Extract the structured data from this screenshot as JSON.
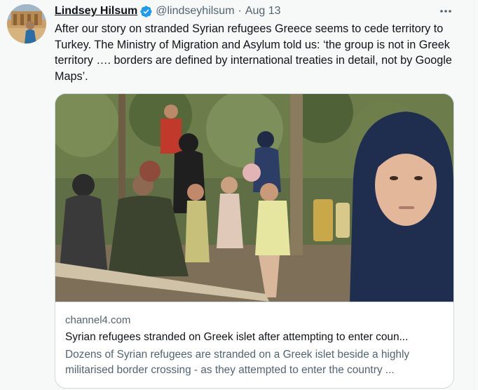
{
  "author": {
    "name": "Lindsey Hilsum",
    "handle": "@lindseyhilsum",
    "separator": "·",
    "date": "Aug 13",
    "verified": true
  },
  "tweet": {
    "text": "After our story on stranded Syrian refugees Greece seems to cede territory to Turkey. The Ministry of Migration and Asylum told us: ‘the group is not in Greek territory …. borders are defined by international treaties in detail, not by Google Maps’."
  },
  "card": {
    "domain": "channel4.com",
    "title": "Syrian refugees stranded on Greek islet after attempting to enter coun...",
    "description": "Dozens of Syrian refugees are stranded on a Greek islet beside a highly militarised border crossing - as they attempted to enter the country ..."
  },
  "icons": {
    "verified": "verified-badge-icon",
    "more": "more-options-icon"
  },
  "colors": {
    "verified": "#1d9bf0",
    "secondary_text": "#536471",
    "border": "#cfd9de"
  }
}
